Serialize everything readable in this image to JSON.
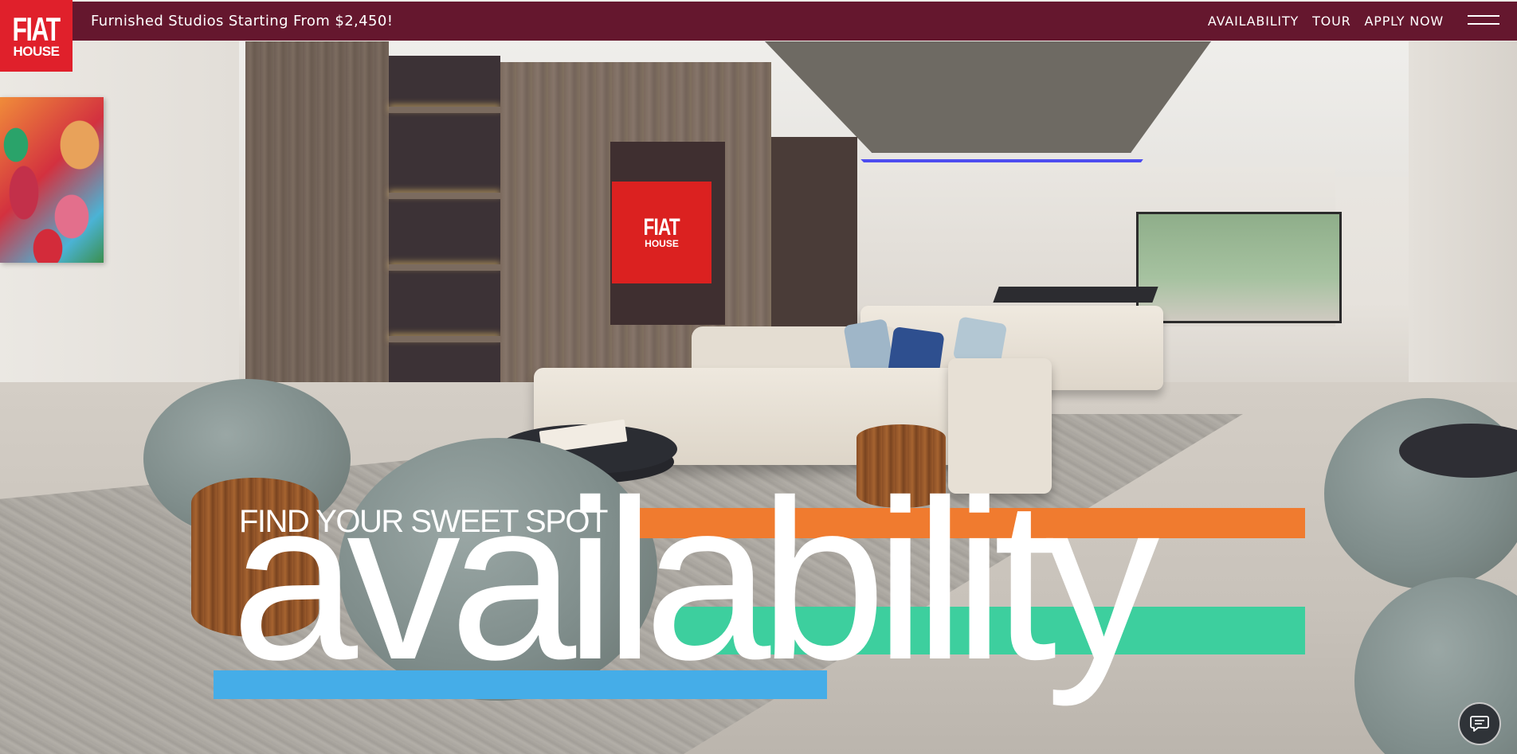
{
  "header": {
    "logo": {
      "line1": "FIAT",
      "line2": "HOUSE"
    },
    "promo_text": "Furnished Studios Starting From $2,450!",
    "nav": [
      {
        "label": "AVAILABILITY"
      },
      {
        "label": "TOUR"
      },
      {
        "label": "APPLY NOW"
      }
    ],
    "menu_icon": "hamburger-menu-icon"
  },
  "hero": {
    "image_alt": "lounge-interior-photo",
    "tv_logo": {
      "line1": "FIAT",
      "line2": "HOUSE"
    },
    "tagline": "FIND YOUR SWEET SPOT",
    "headline": "availability"
  },
  "chat": {
    "icon": "chat-icon"
  },
  "colors": {
    "header_bg": "#65172e",
    "logo_bg": "#e0202b",
    "bar_orange": "#f07b2f",
    "bar_green": "#3dcf9e",
    "bar_blue": "#45ade8",
    "text": "#ffffff"
  }
}
